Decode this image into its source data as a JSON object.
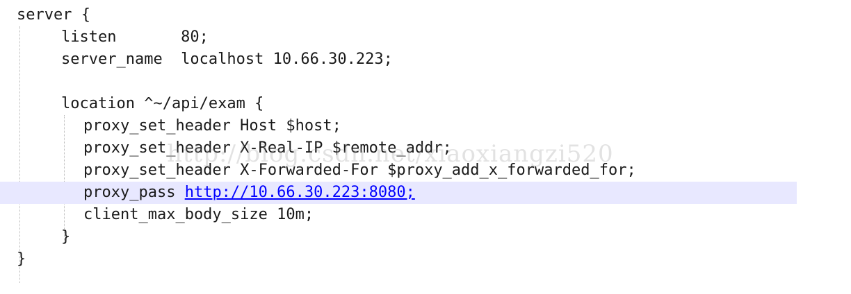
{
  "code_lines": [
    "server {",
    "listen       80;",
    "server_name  localhost 10.66.30.223;",
    "",
    "location ^~/api/exam {",
    "proxy_set_header Host $host;",
    "proxy_set_header X-Real-IP $remote_addr;",
    "proxy_set_header X-Forwarded-For $proxy_add_x_forwarded_for;",
    "proxy_pass ",
    "client_max_body_size 10m;",
    "}",
    "}"
  ],
  "proxy_pass_url": "http://10.66.30.223:8080;",
  "watermark": "http://blog.csdn.net/xiaoxiangzi520",
  "colors": {
    "text": "#1a1a1a",
    "link": "#0000ff",
    "current_line_highlight": "#e8e8ff",
    "indent_guide": "#b8b8b8"
  }
}
